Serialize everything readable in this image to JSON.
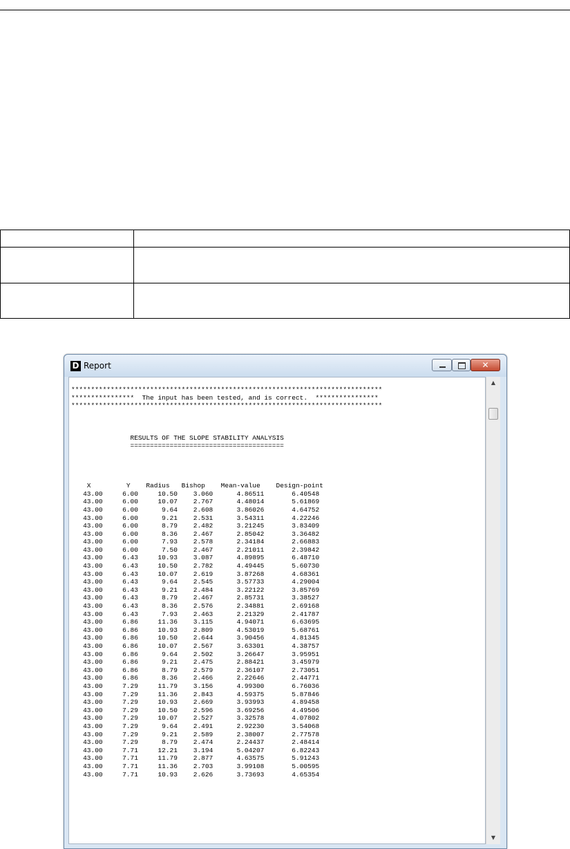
{
  "window": {
    "icon_letter": "D",
    "title": "Report",
    "controls": {
      "close": "✕"
    }
  },
  "report": {
    "banner": [
      "*******************************************************************************",
      "****************  The input has been tested, and is correct.  ****************",
      "*******************************************************************************"
    ],
    "results_title": "RESULTS OF THE SLOPE STABILITY ANALYSIS",
    "results_underline": "=======================================",
    "columns": [
      "X",
      "Y",
      "Radius",
      "Bishop",
      "Mean-value",
      "Design-point"
    ],
    "rows": [
      [
        "43.00",
        "6.00",
        "10.50",
        "3.060",
        "4.86511",
        "6.40548"
      ],
      [
        "43.00",
        "6.00",
        "10.07",
        "2.767",
        "4.48014",
        "5.61869"
      ],
      [
        "43.00",
        "6.00",
        "9.64",
        "2.608",
        "3.86026",
        "4.64752"
      ],
      [
        "43.00",
        "6.00",
        "9.21",
        "2.531",
        "3.54311",
        "4.22246"
      ],
      [
        "43.00",
        "6.00",
        "8.79",
        "2.482",
        "3.21245",
        "3.83409"
      ],
      [
        "43.00",
        "6.00",
        "8.36",
        "2.467",
        "2.85042",
        "3.36482"
      ],
      [
        "43.00",
        "6.00",
        "7.93",
        "2.578",
        "2.34184",
        "2.66883"
      ],
      [
        "43.00",
        "6.00",
        "7.50",
        "2.467",
        "2.21011",
        "2.39842"
      ],
      [
        "43.00",
        "6.43",
        "10.93",
        "3.087",
        "4.89895",
        "6.48710"
      ],
      [
        "43.00",
        "6.43",
        "10.50",
        "2.782",
        "4.49445",
        "5.60730"
      ],
      [
        "43.00",
        "6.43",
        "10.07",
        "2.619",
        "3.87268",
        "4.68361"
      ],
      [
        "43.00",
        "6.43",
        "9.64",
        "2.545",
        "3.57733",
        "4.29004"
      ],
      [
        "43.00",
        "6.43",
        "9.21",
        "2.484",
        "3.22122",
        "3.85769"
      ],
      [
        "43.00",
        "6.43",
        "8.79",
        "2.467",
        "2.85731",
        "3.38527"
      ],
      [
        "43.00",
        "6.43",
        "8.36",
        "2.576",
        "2.34881",
        "2.69168"
      ],
      [
        "43.00",
        "6.43",
        "7.93",
        "2.463",
        "2.21329",
        "2.41787"
      ],
      [
        "43.00",
        "6.86",
        "11.36",
        "3.115",
        "4.94071",
        "6.63695"
      ],
      [
        "43.00",
        "6.86",
        "10.93",
        "2.809",
        "4.53019",
        "5.68761"
      ],
      [
        "43.00",
        "6.86",
        "10.50",
        "2.644",
        "3.90456",
        "4.81345"
      ],
      [
        "43.00",
        "6.86",
        "10.07",
        "2.567",
        "3.63301",
        "4.38757"
      ],
      [
        "43.00",
        "6.86",
        "9.64",
        "2.502",
        "3.26647",
        "3.95951"
      ],
      [
        "43.00",
        "6.86",
        "9.21",
        "2.475",
        "2.88421",
        "3.45979"
      ],
      [
        "43.00",
        "6.86",
        "8.79",
        "2.579",
        "2.36107",
        "2.73051"
      ],
      [
        "43.00",
        "6.86",
        "8.36",
        "2.466",
        "2.22646",
        "2.44771"
      ],
      [
        "43.00",
        "7.29",
        "11.79",
        "3.156",
        "4.99300",
        "6.76036"
      ],
      [
        "43.00",
        "7.29",
        "11.36",
        "2.843",
        "4.59375",
        "5.87846"
      ],
      [
        "43.00",
        "7.29",
        "10.93",
        "2.669",
        "3.93993",
        "4.89458"
      ],
      [
        "43.00",
        "7.29",
        "10.50",
        "2.596",
        "3.69256",
        "4.49506"
      ],
      [
        "43.00",
        "7.29",
        "10.07",
        "2.527",
        "3.32578",
        "4.07802"
      ],
      [
        "43.00",
        "7.29",
        "9.64",
        "2.491",
        "2.92230",
        "3.54068"
      ],
      [
        "43.00",
        "7.29",
        "9.21",
        "2.589",
        "2.38007",
        "2.77578"
      ],
      [
        "43.00",
        "7.29",
        "8.79",
        "2.474",
        "2.24437",
        "2.48414"
      ],
      [
        "43.00",
        "7.71",
        "12.21",
        "3.194",
        "5.04207",
        "6.82243"
      ],
      [
        "43.00",
        "7.71",
        "11.79",
        "2.877",
        "4.63575",
        "5.91243"
      ],
      [
        "43.00",
        "7.71",
        "11.36",
        "2.703",
        "3.99108",
        "5.00595"
      ],
      [
        "43.00",
        "7.71",
        "10.93",
        "2.626",
        "3.73693",
        "4.65354"
      ]
    ]
  }
}
